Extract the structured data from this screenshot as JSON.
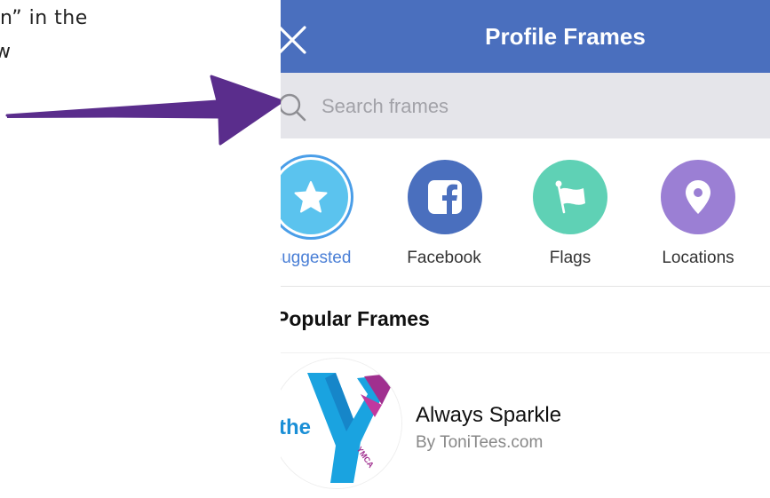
{
  "caption": {
    "line1": "n” in the",
    "line2": "w"
  },
  "header": {
    "title": "Profile Frames",
    "close_icon": "close-icon"
  },
  "search": {
    "placeholder": "Search frames",
    "value": ""
  },
  "categories": [
    {
      "label": "Suggested",
      "icon": "star-icon",
      "color": "#5bc3ee",
      "selected": true
    },
    {
      "label": "Facebook",
      "icon": "facebook-icon",
      "color": "#4a6fbe",
      "selected": false
    },
    {
      "label": "Flags",
      "icon": "flag-icon",
      "color": "#5fd1b5",
      "selected": false
    },
    {
      "label": "Locations",
      "icon": "location-pin-icon",
      "color": "#9b7fd4",
      "selected": false
    }
  ],
  "section": {
    "title": "Popular Frames"
  },
  "frames": [
    {
      "name": "Always Sparkle",
      "author": "By ToniTees.com",
      "thumb_text": "the",
      "thumb_small": "YMCA"
    }
  ],
  "colors": {
    "navbar": "#4a6fbe",
    "accent": "#4a7fd6",
    "arrow": "#5a2d8c"
  }
}
